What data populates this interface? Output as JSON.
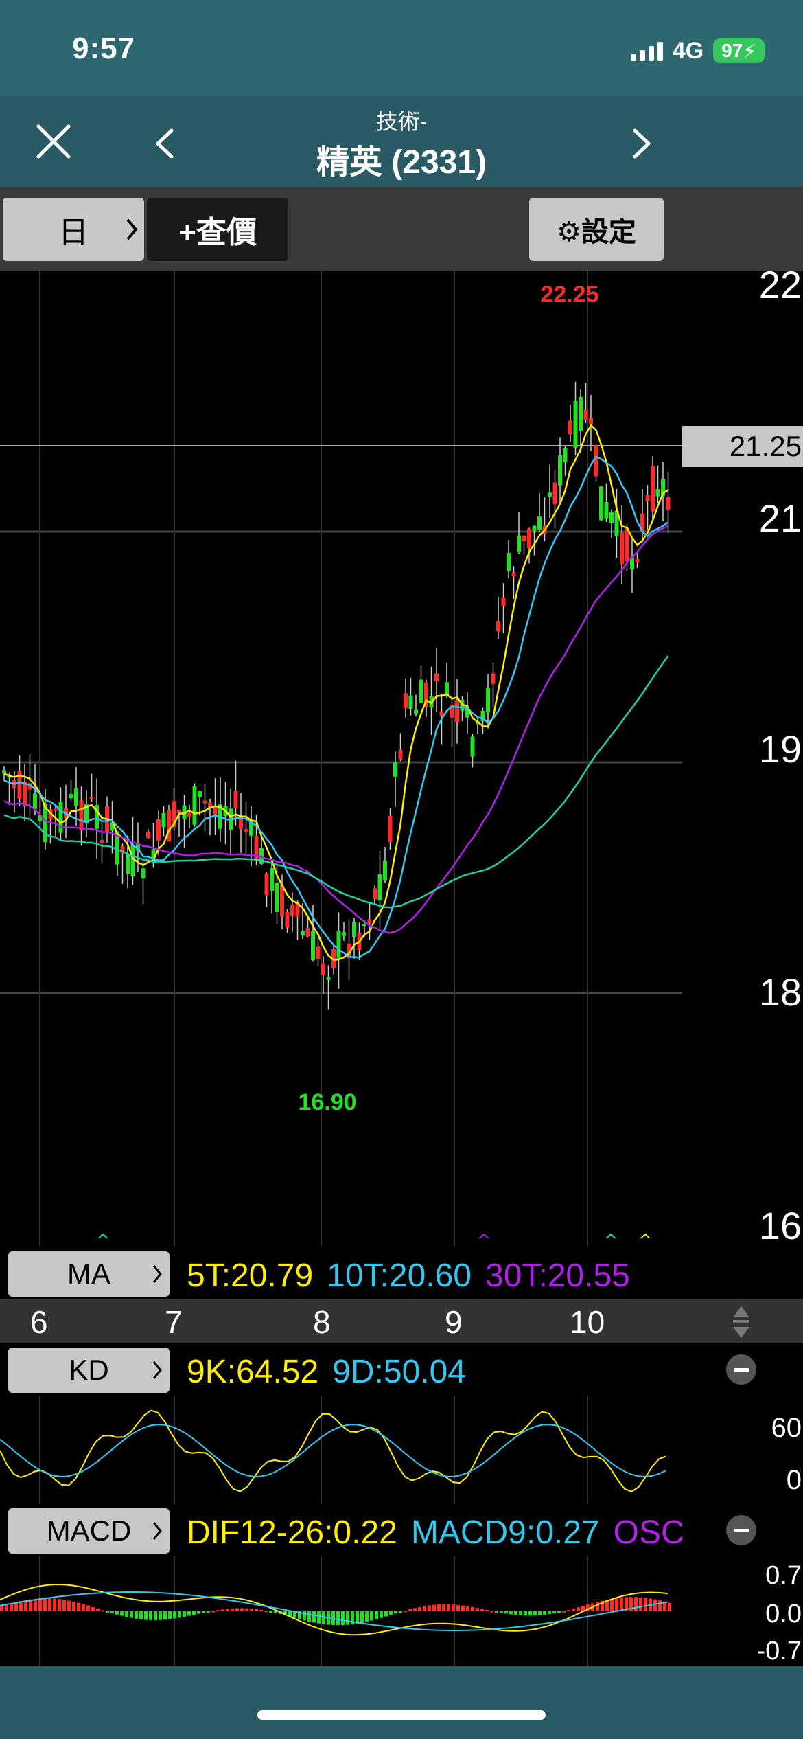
{
  "status": {
    "time": "9:57",
    "network": "4G",
    "battery": "97"
  },
  "nav": {
    "subtitle": "技術-",
    "title": "精英 (2331)"
  },
  "toolbar": {
    "period": "日",
    "quote": "+查價",
    "settings": "⚙設定"
  },
  "main_chart": {
    "y_labels": [
      "22",
      "21",
      "19",
      "18",
      "16"
    ],
    "current_price": "21.25",
    "high_label": "22.25",
    "low_label": "16.90"
  },
  "ma_bar": {
    "label": "MA",
    "v5": "5T:20.79",
    "v10": "10T:20.60",
    "v30": "30T:20.55"
  },
  "x_labels": [
    "6",
    "7",
    "8",
    "9",
    "10"
  ],
  "kd_bar": {
    "label": "KD",
    "k": "9K:64.52",
    "d": "9D:50.04"
  },
  "kd_axis": [
    "60",
    "0"
  ],
  "macd_bar": {
    "label": "MACD",
    "dif": "DIF12-26:0.22",
    "macd": "MACD9:0.27",
    "osc": "OSC"
  },
  "macd_axis": [
    "0.7",
    "0.0",
    "-0.7"
  ],
  "colors": {
    "up": "#ff2a2a",
    "down": "#22e022",
    "ma5": "#ffee00",
    "ma10": "#33c8f0",
    "ma30": "#b020e8",
    "ma60": "#20d0a0"
  },
  "chart_data": {
    "type": "candlestick",
    "x": [
      "6",
      "7",
      "8",
      "9",
      "10"
    ],
    "price_range": [
      16,
      22.25
    ],
    "high": 22.25,
    "low": 16.9,
    "last": 21.25,
    "ma": {
      "5T": 20.79,
      "10T": 20.6,
      "30T": 20.55
    },
    "kd": {
      "K": 64.52,
      "D": 50.04
    },
    "macd": {
      "DIF": 0.22,
      "MACD": 0.27
    }
  }
}
